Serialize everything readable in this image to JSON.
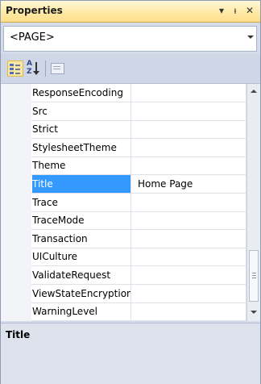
{
  "panel": {
    "title": "Properties"
  },
  "title_buttons": {
    "dropdown": "▾",
    "pin": "ᵼ",
    "close": "✕"
  },
  "object_selector": {
    "value": "<PAGE>"
  },
  "toolbar": {
    "buttons": [
      {
        "icon": "categorized-icon",
        "active": true
      },
      {
        "icon": "alphabetical-icon",
        "active": false
      },
      {
        "icon": "property-pages-icon",
        "active": false
      }
    ],
    "alpha_glyph_top": "A",
    "alpha_glyph_bottom": "Z"
  },
  "properties": [
    {
      "name": "ResponseEncoding",
      "value": ""
    },
    {
      "name": "Src",
      "value": ""
    },
    {
      "name": "Strict",
      "value": ""
    },
    {
      "name": "StylesheetTheme",
      "value": ""
    },
    {
      "name": "Theme",
      "value": ""
    },
    {
      "name": "Title",
      "value": "Home Page",
      "selected": true
    },
    {
      "name": "Trace",
      "value": ""
    },
    {
      "name": "TraceMode",
      "value": ""
    },
    {
      "name": "Transaction",
      "value": ""
    },
    {
      "name": "UICulture",
      "value": ""
    },
    {
      "name": "ValidateRequest",
      "value": ""
    },
    {
      "name": "ViewStateEncryption",
      "value": ""
    },
    {
      "name": "WarningLevel",
      "value": ""
    }
  ],
  "description": {
    "title": "Title"
  },
  "colors": {
    "titlebar": "#ffe9a6",
    "selection": "#3399ff",
    "panel": "#d5dbe8"
  }
}
